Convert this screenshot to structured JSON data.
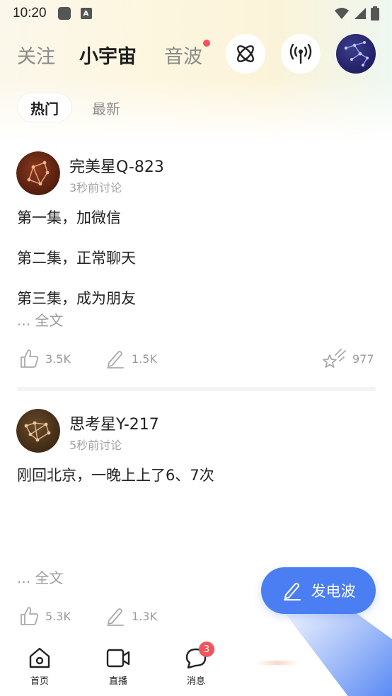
{
  "status_bar": {
    "time": "10:20",
    "a_icon": "A"
  },
  "nav": {
    "tabs": [
      {
        "label": "关注",
        "active": false
      },
      {
        "label": "小宇宙",
        "active": true
      },
      {
        "label": "音波",
        "active": false,
        "has_dot": true
      }
    ],
    "icons": [
      "atom-icon",
      "broadcast-icon",
      "constellation-avatar"
    ]
  },
  "sub_tabs": {
    "hot": "热门",
    "latest": "最新"
  },
  "posts": [
    {
      "name": "完美星Q-823",
      "time": "3秒前讨论",
      "lines": [
        "第一集，加微信",
        "第二集，正常聊天",
        "第三集，成为朋友"
      ],
      "fulltext": "... 全文",
      "likes": "3.5K",
      "comments": "1.5K",
      "stars": "977"
    },
    {
      "name": "思考星Y-217",
      "time": "5秒前讨论",
      "lines": [
        "刚回北京，一晚上上了6、7次"
      ],
      "fulltext": "... 全文",
      "likes": "5.3K",
      "comments": "1.3K"
    }
  ],
  "fab": {
    "label": "发电波"
  },
  "bottom_nav": [
    {
      "label": "首页",
      "icon": "home-icon"
    },
    {
      "label": "直播",
      "icon": "video-icon"
    },
    {
      "label": "消息",
      "icon": "message-icon",
      "badge": "3"
    }
  ],
  "colors": {
    "accent": "#4a7ef2",
    "badge": "#f2545b",
    "muted": "#9a9a9a"
  }
}
